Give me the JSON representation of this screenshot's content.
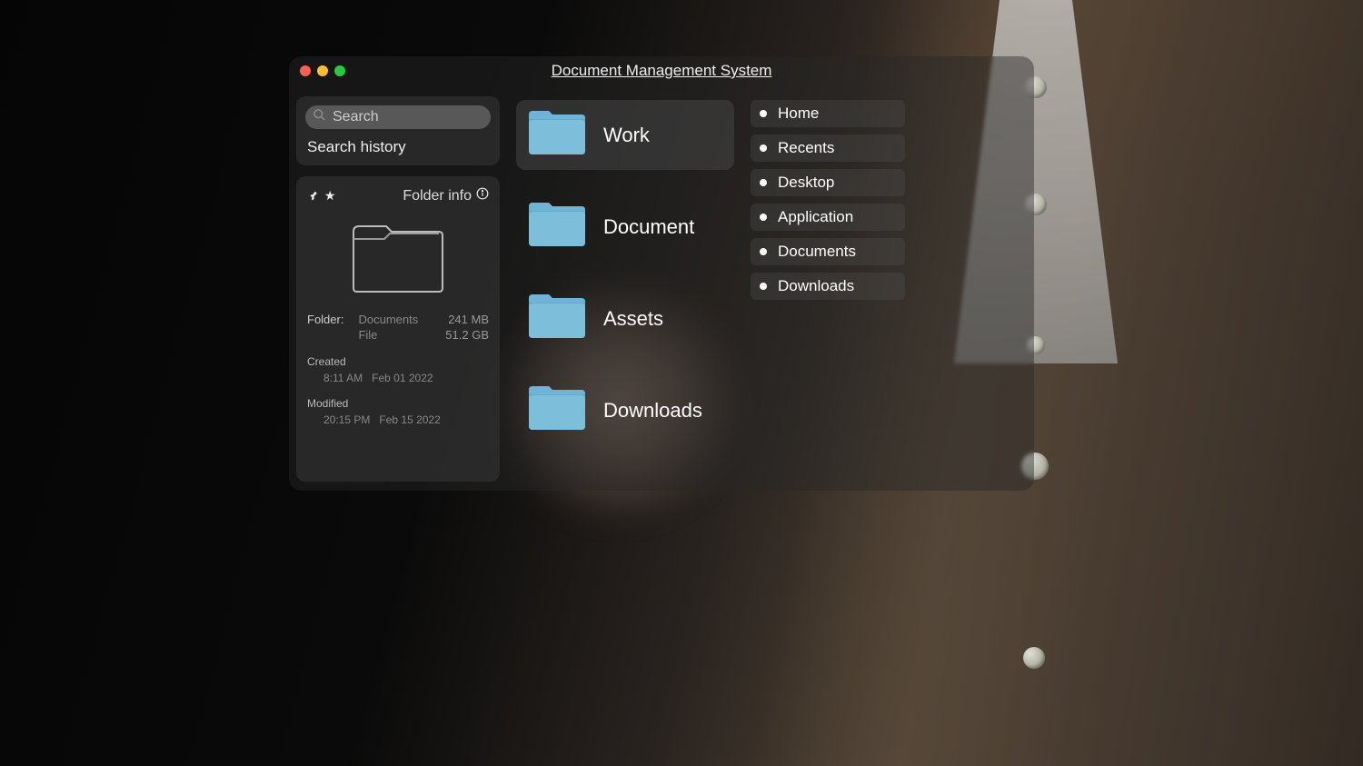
{
  "window": {
    "title": "Document Management System"
  },
  "search": {
    "placeholder": "Search",
    "history_label": "Search history"
  },
  "info": {
    "title": "Folder info",
    "folder_label": "Folder:",
    "folder_name": "Documents",
    "folder_size": "241 MB",
    "file_label": "File",
    "file_size": "51.2 GB",
    "created_label": "Created",
    "created_time": "8:11 AM",
    "created_date": "Feb 01 2022",
    "modified_label": "Modified",
    "modified_time": "20:15 PM",
    "modified_date": "Feb 15 2022"
  },
  "folders": [
    {
      "label": "Work",
      "selected": true
    },
    {
      "label": "Document",
      "selected": false
    },
    {
      "label": "Assets",
      "selected": false
    },
    {
      "label": "Downloads",
      "selected": false
    }
  ],
  "nav": [
    {
      "label": "Home"
    },
    {
      "label": "Recents"
    },
    {
      "label": "Desktop"
    },
    {
      "label": "Application"
    },
    {
      "label": "Documents"
    },
    {
      "label": "Downloads"
    }
  ],
  "colors": {
    "folder_blue": "#6FB4D6"
  }
}
